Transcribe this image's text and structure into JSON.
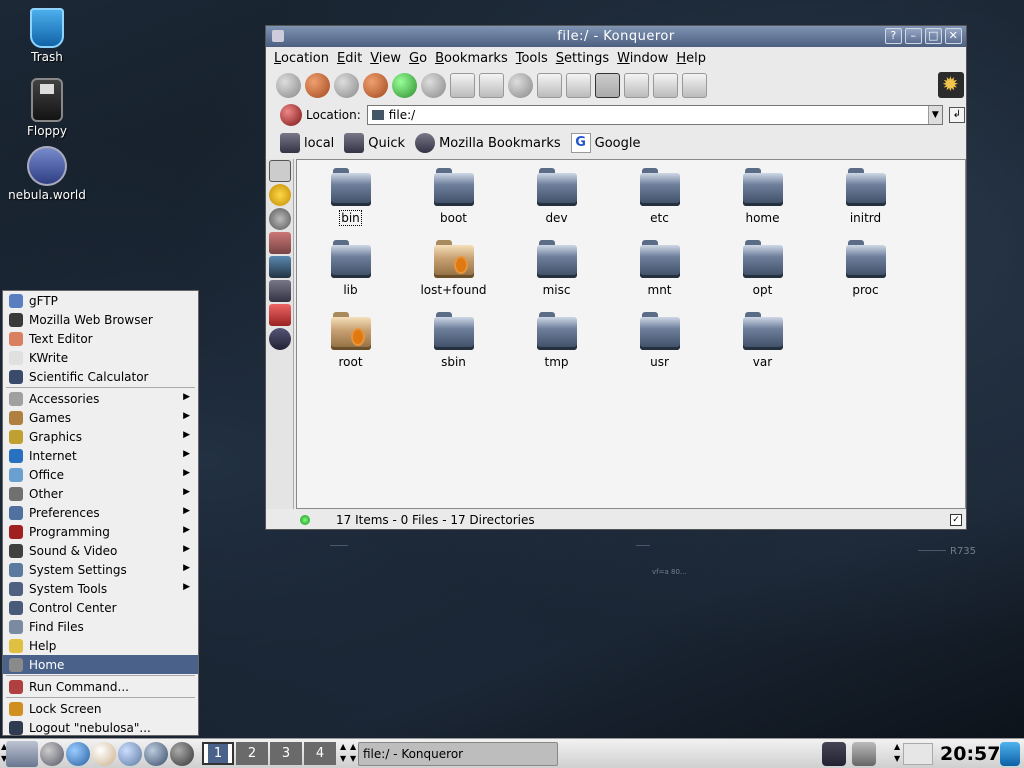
{
  "desktop": {
    "icons": [
      {
        "label": "Trash"
      },
      {
        "label": "Floppy"
      },
      {
        "label": "nebula.world"
      }
    ],
    "watermark": "R735",
    "watermark_small": "vf=a 80..."
  },
  "window": {
    "title": "file:/ - Konqueror",
    "buttons": {
      "help": "?",
      "minimize": "–",
      "maximize": "□",
      "close": "✕"
    },
    "menus": [
      "Location",
      "Edit",
      "View",
      "Go",
      "Bookmarks",
      "Tools",
      "Settings",
      "Window",
      "Help"
    ],
    "location_label": "Location:",
    "location_value": "file:/",
    "bookmarks": [
      {
        "label": "local"
      },
      {
        "label": "Quick"
      },
      {
        "label": "Mozilla Bookmarks"
      },
      {
        "label": "Google"
      }
    ],
    "files": [
      {
        "name": "bin",
        "locked": false,
        "selected": true
      },
      {
        "name": "boot",
        "locked": false
      },
      {
        "name": "dev",
        "locked": false
      },
      {
        "name": "etc",
        "locked": false
      },
      {
        "name": "home",
        "locked": false
      },
      {
        "name": "initrd",
        "locked": false
      },
      {
        "name": "lib",
        "locked": false
      },
      {
        "name": "lost+found",
        "locked": true
      },
      {
        "name": "misc",
        "locked": false
      },
      {
        "name": "mnt",
        "locked": false
      },
      {
        "name": "opt",
        "locked": false
      },
      {
        "name": "proc",
        "locked": false
      },
      {
        "name": "root",
        "locked": true
      },
      {
        "name": "sbin",
        "locked": false
      },
      {
        "name": "tmp",
        "locked": false
      },
      {
        "name": "usr",
        "locked": false
      },
      {
        "name": "var",
        "locked": false
      }
    ],
    "status": "17 Items - 0 Files - 17 Directories"
  },
  "kmenu": {
    "items": [
      {
        "label": "gFTP",
        "icon": "ftp-icon",
        "color": "#5a7fc0"
      },
      {
        "label": "Mozilla Web Browser",
        "icon": "mozilla-icon",
        "color": "#3a3a3a"
      },
      {
        "label": "Text Editor",
        "icon": "text-editor-icon",
        "color": "#d88060"
      },
      {
        "label": "KWrite",
        "icon": "kwrite-icon",
        "color": "#e0e0e0"
      },
      {
        "label": "Scientific Calculator",
        "icon": "calculator-icon",
        "color": "#3a4a6a"
      },
      {
        "sep": true
      },
      {
        "label": "Accessories",
        "icon": "accessories-icon",
        "color": "#a0a0a0",
        "submenu": true
      },
      {
        "label": "Games",
        "icon": "games-icon",
        "color": "#b08040",
        "submenu": true
      },
      {
        "label": "Graphics",
        "icon": "graphics-icon",
        "color": "#c0a030",
        "submenu": true
      },
      {
        "label": "Internet",
        "icon": "internet-icon",
        "color": "#2a70c0",
        "submenu": true
      },
      {
        "label": "Office",
        "icon": "office-icon",
        "color": "#6aa0d0",
        "submenu": true
      },
      {
        "label": "Other",
        "icon": "other-icon",
        "color": "#707070",
        "submenu": true
      },
      {
        "label": "Preferences",
        "icon": "preferences-icon",
        "color": "#5070a0",
        "submenu": true
      },
      {
        "label": "Programming",
        "icon": "programming-icon",
        "color": "#a02020",
        "submenu": true
      },
      {
        "label": "Sound & Video",
        "icon": "sound-video-icon",
        "color": "#404040",
        "submenu": true
      },
      {
        "label": "System Settings",
        "icon": "system-settings-icon",
        "color": "#5a7aa0",
        "submenu": true
      },
      {
        "label": "System Tools",
        "icon": "system-tools-icon",
        "color": "#506080",
        "submenu": true
      },
      {
        "label": "Control Center",
        "icon": "control-center-icon",
        "color": "#4a5a7a"
      },
      {
        "label": "Find Files",
        "icon": "find-files-icon",
        "color": "#7a8aa0"
      },
      {
        "label": "Help",
        "icon": "help-icon",
        "color": "#e0c040"
      },
      {
        "label": "Home",
        "icon": "home-icon",
        "color": "#8a8a8a",
        "highlight": true
      },
      {
        "sep": true
      },
      {
        "label": "Run Command...",
        "icon": "run-command-icon",
        "color": "#b04040"
      },
      {
        "sep": true
      },
      {
        "label": "Lock Screen",
        "icon": "lock-screen-icon",
        "color": "#d09020"
      },
      {
        "label": "Logout \"nebulosa\"...",
        "icon": "logout-icon",
        "color": "#303a50"
      }
    ]
  },
  "taskbar": {
    "desktops": [
      "1",
      "2",
      "3",
      "4"
    ],
    "active_desktop": "1",
    "task": "file:/ - Konqueror",
    "clock": "20:57",
    "colors": {
      "highlight": "#4a6289"
    }
  }
}
